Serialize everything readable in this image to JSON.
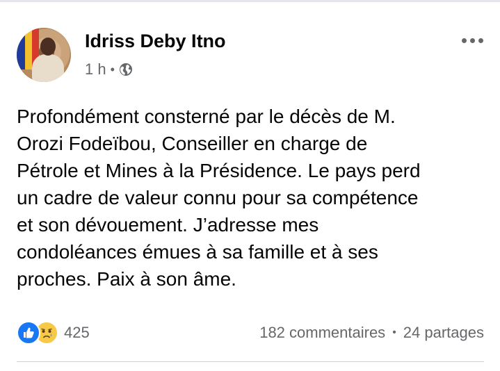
{
  "post": {
    "author": "Idriss Deby Itno",
    "time": "1 h",
    "meta_separator": "•",
    "privacy_icon": "globe-icon",
    "body": "Profondément consterné par le décès de M.\nOrozi Fodeïbou, Conseiller en charge de\nPétrole et Mines à la Présidence. Le pays perd\nun cadre de valeur connu pour sa compétence\net son dévouement. J’adresse mes\ncondoléances émues à sa famille et à ses\nproches. Paix à son âme."
  },
  "stats": {
    "reaction_icons": [
      "like-icon",
      "sad-icon"
    ],
    "reaction_count": "425",
    "comments": "182 commentaires",
    "separator": "•",
    "shares": "24 partages"
  },
  "colors": {
    "like_blue": "#1877f2",
    "sad_yellow": "#f7c948",
    "secondary_text": "#65676b",
    "primary_text": "#050505"
  }
}
